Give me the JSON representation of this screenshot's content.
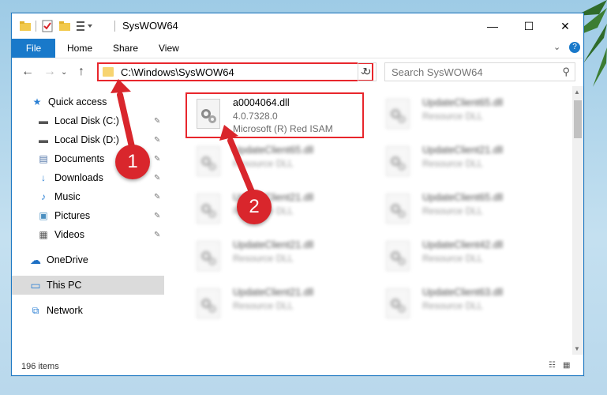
{
  "window": {
    "title": "SysWOW64",
    "controls": {
      "minimize": "—",
      "maximize": "☐",
      "close": "✕"
    }
  },
  "ribbon": {
    "tabs": [
      "File",
      "Home",
      "Share",
      "View"
    ],
    "expand_glyph": "⌄",
    "help_glyph": "?"
  },
  "address_bar": {
    "path": "C:\\Windows\\SysWOW64",
    "refresh_glyph": "↻",
    "dropdown_glyph": "⌄"
  },
  "search": {
    "placeholder": "Search SysWOW64"
  },
  "nav_buttons": {
    "back": "←",
    "forward": "→",
    "history": "⌄",
    "up": "↑"
  },
  "nav_pane": {
    "items": [
      {
        "label": "Quick access",
        "icon": "star-icon",
        "glyph": "★",
        "color": "#2a7fd4"
      },
      {
        "label": "Local Disk (C:)",
        "icon": "drive-icon",
        "glyph": "▬",
        "color": "#555555"
      },
      {
        "label": "Local Disk (D:)",
        "icon": "drive-icon",
        "glyph": "▬",
        "color": "#555555"
      },
      {
        "label": "Documents",
        "icon": "documents-icon",
        "glyph": "▤",
        "color": "#4a6fa5"
      },
      {
        "label": "Downloads",
        "icon": "downloads-icon",
        "glyph": "↓",
        "color": "#2a7fd4"
      },
      {
        "label": "Music",
        "icon": "music-icon",
        "glyph": "♪",
        "color": "#2a7fd4"
      },
      {
        "label": "Pictures",
        "icon": "pictures-icon",
        "glyph": "▣",
        "color": "#4a8fc0"
      },
      {
        "label": "Videos",
        "icon": "videos-icon",
        "glyph": "▦",
        "color": "#555555"
      },
      {
        "label": "OneDrive",
        "icon": "onedrive-icon",
        "glyph": "☁",
        "color": "#1d6fc4"
      },
      {
        "label": "This PC",
        "icon": "computer-icon",
        "glyph": "▭",
        "color": "#2a7fd4"
      },
      {
        "label": "Network",
        "icon": "network-icon",
        "glyph": "⧉",
        "color": "#2a7fd4"
      }
    ],
    "pin_glyph": "📌"
  },
  "files": [
    {
      "name": "a0004064.dll",
      "line2": "4.0.7328.0",
      "line3": "Microsoft (R) Red ISAM",
      "highlighted": true
    },
    {
      "name": "UpdateClient65.dll",
      "line2": "Resource DLL"
    },
    {
      "name": "UpdateClient65.dll",
      "line2": "Resource DLL"
    },
    {
      "name": "UpdateClient21.dll",
      "line2": "Resource DLL"
    },
    {
      "name": "UpdateClient21.dll",
      "line2": "Resource DLL"
    },
    {
      "name": "UpdateClient65.dll",
      "line2": "Resource DLL"
    },
    {
      "name": "UpdateClient21.dll",
      "line2": "Resource DLL"
    },
    {
      "name": "UpdateClient42.dll",
      "line2": "Resource DLL"
    },
    {
      "name": "UpdateClient21.dll",
      "line2": "Resource DLL"
    },
    {
      "name": "UpdateClient63.dll",
      "line2": "Resource DLL"
    }
  ],
  "status_bar": {
    "item_count": "196 items"
  },
  "callouts": [
    {
      "number": "1"
    },
    {
      "number": "2"
    }
  ],
  "colors": {
    "accent": "#1979ca",
    "highlight": "#e8262c",
    "callout": "#d9262c"
  }
}
